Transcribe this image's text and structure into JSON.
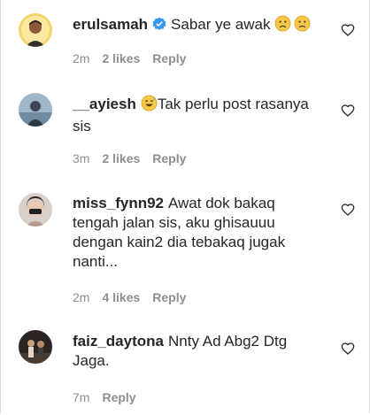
{
  "comments": [
    {
      "username": "erulsamah",
      "verified": true,
      "text": "Sabar ye awak ",
      "emoji": [
        "crying-face",
        "crying-face"
      ],
      "time": "2m",
      "likes": "2 likes",
      "reply": "Reply"
    },
    {
      "username": "__ayiesh",
      "verified": false,
      "emoji_prefix": "sweat-smile-face",
      "text": "Tak perlu post rasanya sis",
      "time": "3m",
      "likes": "2 likes",
      "reply": "Reply"
    },
    {
      "username": "miss_fynn92",
      "verified": false,
      "text": "Awat dok bakaq tengah jalan sis, aku ghisauuu dengan kain2 dia tebakaq jugak nanti...",
      "time": "2m",
      "likes": "4 likes",
      "reply": "Reply"
    },
    {
      "username": "faiz_daytona",
      "verified": false,
      "text": "Nnty Ad Abg2 Dtg Jaga.",
      "time": "7m",
      "likes": "",
      "reply": "Reply"
    }
  ],
  "colors": {
    "primary_text": "#262626",
    "secondary_text": "#8e8e8e",
    "verified_blue": "#3897f0",
    "emoji_yellow": "#f7c948"
  }
}
